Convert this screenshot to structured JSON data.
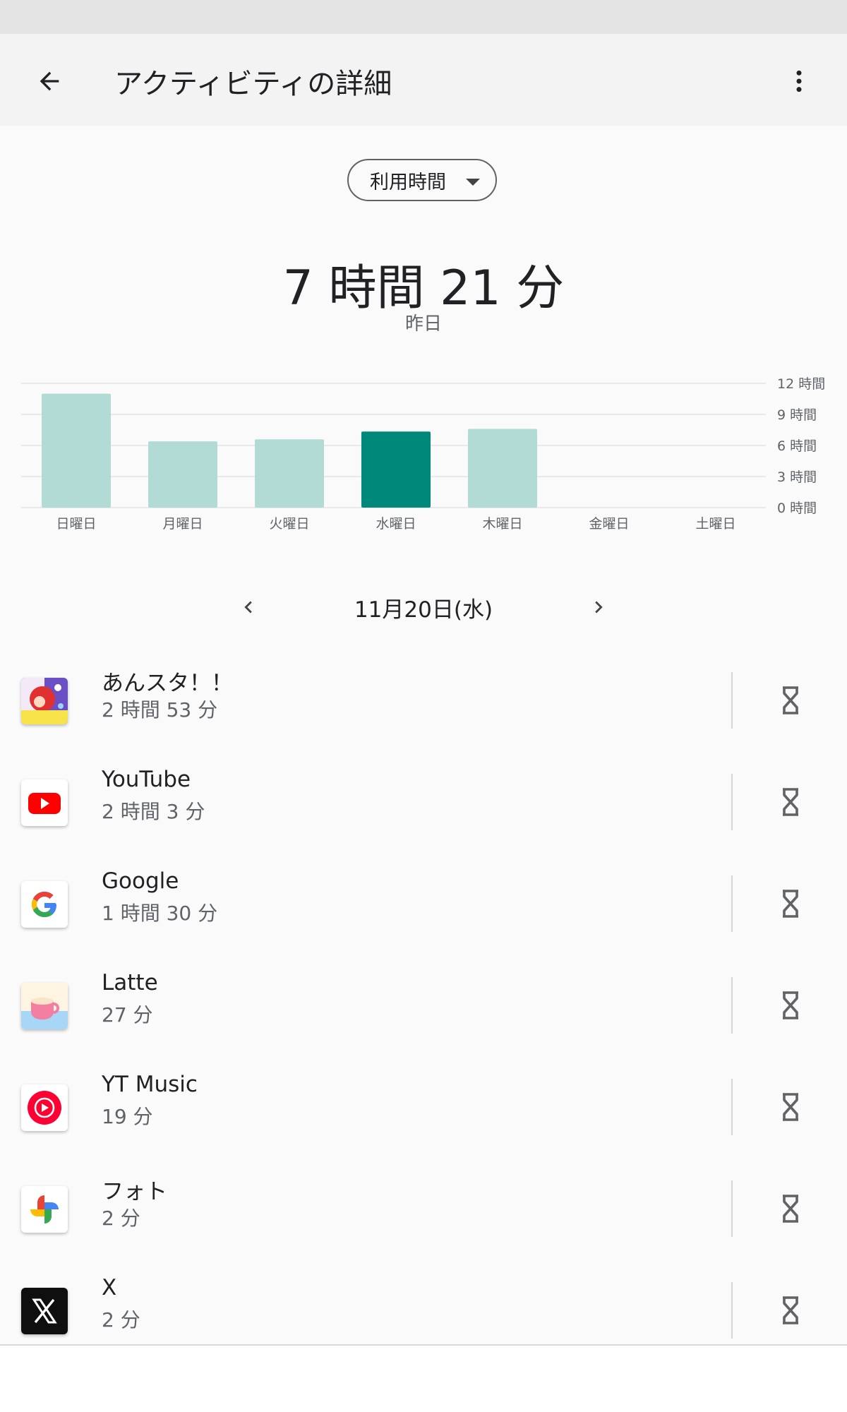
{
  "header": {
    "title": "アクティビティの詳細",
    "back_icon": "arrow-back-icon",
    "menu_icon": "more-vert-icon"
  },
  "metric_selector": {
    "selected": "利用時間"
  },
  "summary": {
    "total": "7 時間 21 分",
    "label": "昨日"
  },
  "chart_data": {
    "type": "bar",
    "categories": [
      "日曜日",
      "月曜日",
      "火曜日",
      "水曜日",
      "木曜日",
      "金曜日",
      "土曜日"
    ],
    "values": [
      11.0,
      6.4,
      6.6,
      7.35,
      7.6,
      0,
      0
    ],
    "highlight_index": 3,
    "y_ticks": [
      0,
      3,
      6,
      9,
      12
    ],
    "y_tick_labels": [
      "0 時間",
      "3 時間",
      "6 時間",
      "9 時間",
      "12 時間"
    ],
    "ylim": [
      0,
      12
    ],
    "grid": true,
    "colors": {
      "bar": "#b2dbd5",
      "highlight": "#00897b",
      "grid": "#e3e3e3"
    }
  },
  "date_nav": {
    "label": "11月20日(水)",
    "prev_icon": "chevron-left-icon",
    "next_icon": "chevron-right-icon"
  },
  "apps": [
    {
      "name": "あんスタ！！",
      "time": "2 時間 53 分",
      "icon": "ensemble-stars-icon"
    },
    {
      "name": "YouTube",
      "time": "2 時間 3 分",
      "icon": "youtube-icon"
    },
    {
      "name": "Google",
      "time": "1 時間 30 分",
      "icon": "google-icon"
    },
    {
      "name": "Latte",
      "time": "27 分",
      "icon": "latte-icon"
    },
    {
      "name": "YT Music",
      "time": "19 分",
      "icon": "yt-music-icon"
    },
    {
      "name": "フォト",
      "time": "2 分",
      "icon": "photos-icon"
    },
    {
      "name": "X",
      "time": "2 分",
      "icon": "x-icon"
    }
  ],
  "timer_icon": "hourglass-icon"
}
